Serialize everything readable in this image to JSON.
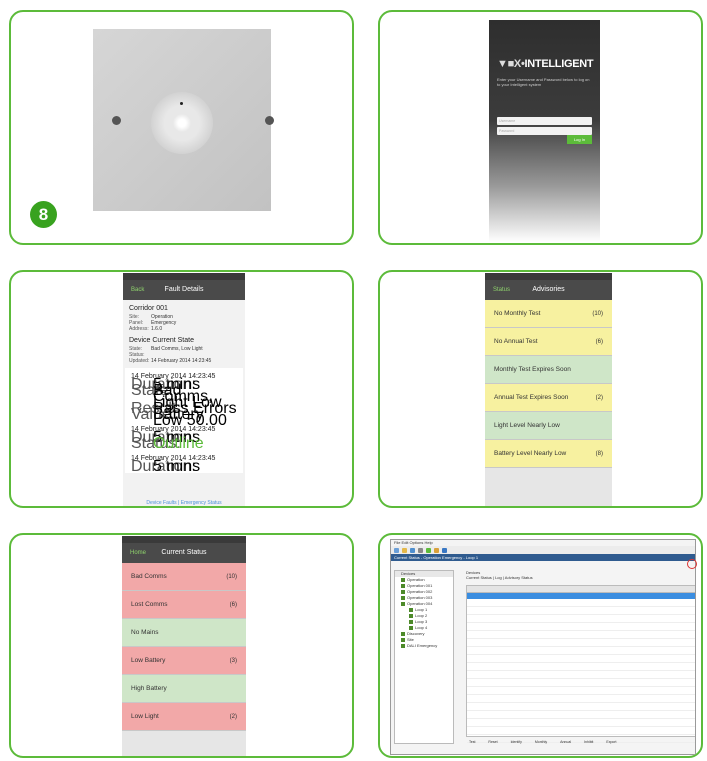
{
  "panel1": {
    "badge": "8"
  },
  "panel2": {
    "logo": "INTELLIGENT",
    "logo_mark": "▼■X•",
    "intro": "Enter your Username and Password below to log on to your Intelligent system",
    "username_placeholder": "Username",
    "password_placeholder": "Password",
    "login_button": "Log In"
  },
  "panel3": {
    "time": "14:23",
    "title": "Fault Details",
    "back": "Back",
    "device_name": "Corridor 001",
    "site_label": "Site:",
    "site": "Operation",
    "panel_label": "Panel:",
    "panel": "Emergency",
    "address_label": "Address:",
    "address": "1.6.0",
    "status_heading": "Device Current State",
    "state_label": "State:",
    "state": "Bad Comms, Low Light",
    "status_label": "Status:",
    "status": "",
    "updated_label": "Updated:",
    "updated": "14 February 2014 14:23:45",
    "entries": [
      {
        "date": "14 February 2014 14:23:45",
        "lines": [
          [
            "Duration:",
            "5 mins"
          ],
          [
            "State:",
            "Bad Comms, Light Low"
          ],
          [
            "Result:",
            "Pass Errors"
          ],
          [
            "Value:",
            "Battery Low 50.00"
          ]
        ]
      },
      {
        "date": "14 February 2014 14:23:45",
        "lines": [
          [
            "Duration:",
            "5 mins"
          ],
          [
            "Status:",
            "Outline"
          ]
        ]
      },
      {
        "date": "14 February 2014 14:23:45",
        "lines": [
          [
            "Duration:",
            "5 mins"
          ]
        ]
      }
    ],
    "link_left": "Device Faults",
    "link_right": "Emergency Status"
  },
  "panel4": {
    "back": "Status",
    "title": "Advisories",
    "items": [
      {
        "label": "No Monthly Test",
        "count": "(10)",
        "color": "yellow"
      },
      {
        "label": "No Annual Test",
        "count": "(6)",
        "color": "yellow"
      },
      {
        "label": "Monthly Test Expires Soon",
        "count": "",
        "color": "green"
      },
      {
        "label": "Annual Test Expires Soon",
        "count": "(2)",
        "color": "yellow"
      },
      {
        "label": "Light Level Nearly Low",
        "count": "",
        "color": "green"
      },
      {
        "label": "Battery Level Nearly Low",
        "count": "(8)",
        "color": "yellow"
      }
    ]
  },
  "panel5": {
    "back": "Home",
    "title": "Current Status",
    "items": [
      {
        "label": "Bad Comms",
        "count": "(10)",
        "color": "red"
      },
      {
        "label": "Lost Comms",
        "count": "(6)",
        "color": "red"
      },
      {
        "label": "No Mains",
        "count": "",
        "color": "green"
      },
      {
        "label": "Low Battery",
        "count": "(3)",
        "color": "red"
      },
      {
        "label": "High Battery",
        "count": "",
        "color": "green"
      },
      {
        "label": "Low Light",
        "count": "(2)",
        "color": "red"
      }
    ]
  },
  "panel6": {
    "menu": "File  Edit  Options  Help",
    "window_title": "Current Status - Operation Emergency - Loop 1",
    "tree_header": "Devices",
    "tree_items": [
      "Operation",
      "Operation 001",
      "Operation 002",
      "Operation 003",
      "Operation 004",
      "Loop 1",
      "Loop 2",
      "Loop 3",
      "Loop 4",
      "Discovery",
      "Site",
      "DALI Emergency"
    ],
    "tabs": [
      "Current Status",
      "Log",
      "Advisory Status"
    ],
    "panel_label": "Devices",
    "buttons": [
      "Test",
      "Reset",
      "Identify",
      "Monthly",
      "Annual",
      "Inhibit",
      "Export"
    ]
  }
}
